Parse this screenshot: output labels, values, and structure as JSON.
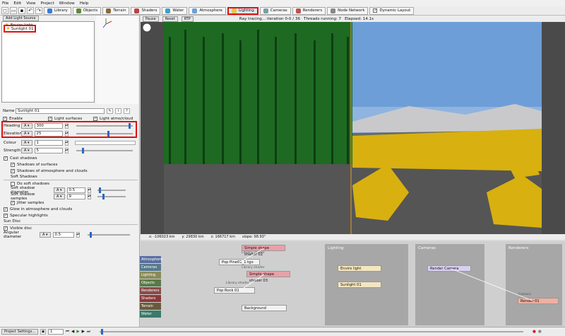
{
  "menu": [
    "File",
    "Edit",
    "View",
    "Project",
    "Window",
    "Help"
  ],
  "toolbar": {
    "tabs": [
      {
        "label": "Library",
        "color": "#3a7bd5"
      },
      {
        "label": "Objects",
        "color": "#5c8a3a"
      },
      {
        "label": "Terrain",
        "color": "#8a6a3a"
      },
      {
        "label": "Shaders",
        "color": "#c04040"
      },
      {
        "label": "Water",
        "color": "#3aa0c8"
      },
      {
        "label": "Atmosphere",
        "color": "#6aa0d8"
      },
      {
        "label": "Lighting",
        "color": "#e8c848"
      },
      {
        "label": "Cameras",
        "color": "#7aa0a0"
      },
      {
        "label": "Renderers",
        "color": "#c05050"
      },
      {
        "label": "Node Network",
        "color": "#888888"
      }
    ],
    "dynamic_layout": "Dynamic Layout"
  },
  "left": {
    "add_light_source": "Add Light Source",
    "tree_items": [
      "Enviro light",
      "Sunlight 01"
    ],
    "name_label": "Name",
    "name_value": "Sunlight 01",
    "enable": "Enable",
    "light_surfaces": "Light surfaces",
    "light_atmo": "Light atmo/cloud",
    "heading_label": "Heading",
    "heading_value": "300",
    "elevation_label": "Elevation",
    "elevation_value": "25",
    "colour_label": "Colour",
    "colour_value": "1",
    "strength_label": "Strength",
    "strength_value": "5",
    "cast_shadows": "Cast shadows",
    "shadows_surfaces": "Shadows of surfaces",
    "shadows_atmo": "Shadows of atmosphere and clouds",
    "soft_shadows": "Soft Shadows",
    "do_soft_shadows": "Do soft shadows",
    "soft_diam_label": "Soft shadow diameter",
    "soft_diam_value": "0.5",
    "soft_samples_label": "Soft shadow samples",
    "soft_samples_value": "9",
    "jitter": "Jitter samples",
    "glow": "Glow in atmosphere and clouds",
    "specular": "Specular highlights",
    "sun_disc": "Sun Disc",
    "visible_disc": "Visible disc",
    "angular_label": "Angular diameter",
    "angular_value": "0.5",
    "heading_fraction": 0.93,
    "elevation_fraction": 0.56,
    "strength_fraction": 0.1,
    "soft_diam_fraction": 0.05,
    "soft_samples_fraction": 0.18,
    "angular_fraction": 0.05
  },
  "viewport": {
    "pause": "Pause",
    "reset": "Reset",
    "rtp": "RTP",
    "status": "Ray tracing... iteration 0-0 / 36",
    "threads": "Threads running: 7",
    "elapsed": "Elapsed: 14.1s",
    "coords": [
      "x: -106023 km",
      "y: 29830 km",
      "z: 166717 km",
      "slope: 98.93°"
    ]
  },
  "nodes": {
    "categories": [
      {
        "label": "Atmosphere",
        "color": "#5a6ea0"
      },
      {
        "label": "Cameras",
        "color": "#587a8a"
      },
      {
        "label": "Lighting",
        "color": "#8a8a5a"
      },
      {
        "label": "Objects",
        "color": "#5a7a4a"
      },
      {
        "label": "Renderers",
        "color": "#8a4a4a"
      },
      {
        "label": "Shaders",
        "color": "#8a3a3a"
      },
      {
        "label": "Terrain",
        "color": "#6a5a3a"
      },
      {
        "label": "Water",
        "color": "#3a7a6a"
      }
    ],
    "columns": [
      "Lighting",
      "Cameras",
      "Renderers"
    ],
    "shader1": "Simple shape shader 02",
    "shader2": "Simple shape shader 03",
    "pop1": "Pop Pine01_1.tgo",
    "pop2": "Pop Rock 01",
    "background": "Background",
    "enviro": "Enviro light",
    "sunlight": "Sunlight 01",
    "render_camera": "Render Camera",
    "renderer": "Render 01",
    "lib_shader1": "Library shader",
    "lib_shader2": "Library shader",
    "lib_shader3": "Library shader",
    "lib_camera": "Camera"
  },
  "status": {
    "project_settings": "Project Settings...",
    "frame": "1"
  }
}
